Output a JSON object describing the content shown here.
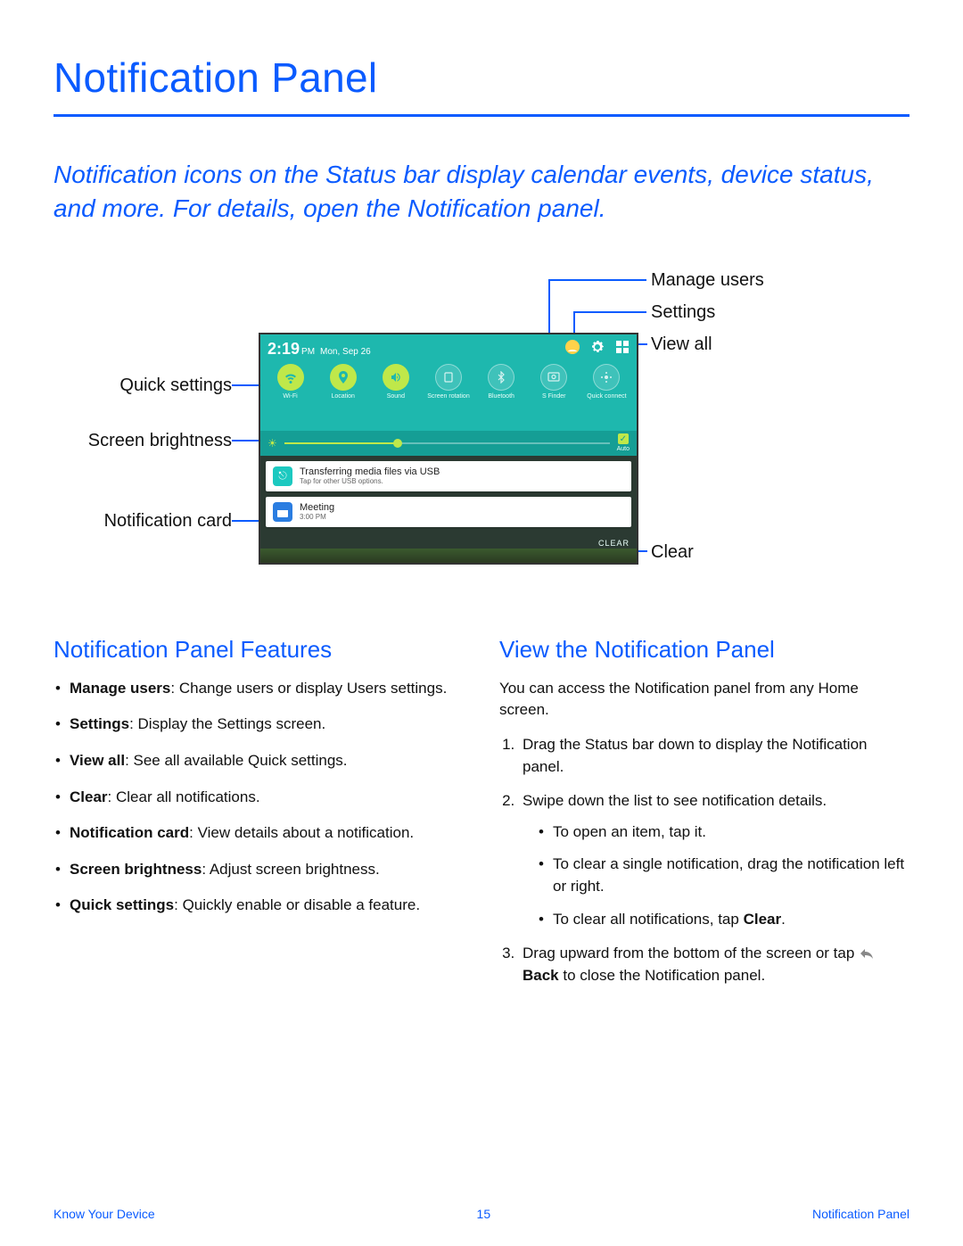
{
  "title": "Notification Panel",
  "intro": "Notification icons on the Status bar display calendar events, device status, and more. For details, open the Notification panel.",
  "callouts": {
    "manage_users": "Manage users",
    "settings": "Settings",
    "view_all": "View all",
    "quick_settings": "Quick settings",
    "screen_brightness": "Screen brightness",
    "notification_card": "Notification card",
    "clear": "Clear"
  },
  "phone": {
    "time": "2:19",
    "ampm": "PM",
    "date": "Mon, Sep 26",
    "quick_settings": [
      {
        "label": "Wi-Fi",
        "on": true
      },
      {
        "label": "Location",
        "on": true
      },
      {
        "label": "Sound",
        "on": true
      },
      {
        "label": "Screen rotation",
        "on": false
      },
      {
        "label": "Bluetooth",
        "on": false
      },
      {
        "label": "S Finder",
        "on": false
      },
      {
        "label": "Quick connect",
        "on": false
      }
    ],
    "brightness_auto": "Auto",
    "notif1_title": "Transferring media files via USB",
    "notif1_sub": "Tap for other USB options.",
    "notif2_title": "Meeting",
    "notif2_sub": "3:00 PM",
    "clear_label": "CLEAR"
  },
  "features": {
    "heading": "Notification Panel Features",
    "items": [
      {
        "term": "Manage users",
        "desc": ": Change users or display Users settings."
      },
      {
        "term": "Settings",
        "desc": ": Display the Settings screen."
      },
      {
        "term": "View all",
        "desc": ": See all available Quick settings."
      },
      {
        "term": "Clear",
        "desc": ": Clear all notifications."
      },
      {
        "term": "Notification card",
        "desc": ": View details about a notification."
      },
      {
        "term": "Screen brightness",
        "desc": ": Adjust screen brightness."
      },
      {
        "term": "Quick settings",
        "desc": ": Quickly enable or disable a feature."
      }
    ]
  },
  "view": {
    "heading": "View the Notification Panel",
    "intro": "You can access the Notification panel from any Home screen.",
    "step1": "Drag the Status bar down to display the Notification panel.",
    "step2": "Swipe down the list to see notification details.",
    "sub1": "To open an item, tap it.",
    "sub2": "To clear a single notification, drag the notification left or right.",
    "sub3_pre": "To clear all notifications, tap ",
    "sub3_bold": "Clear",
    "sub3_post": ".",
    "step3_pre": "Drag upward from the bottom of the screen or tap ",
    "step3_bold": "Back",
    "step3_post": " to close the Notification panel."
  },
  "footer": {
    "left": "Know Your Device",
    "page": "15",
    "right": "Notification Panel"
  }
}
